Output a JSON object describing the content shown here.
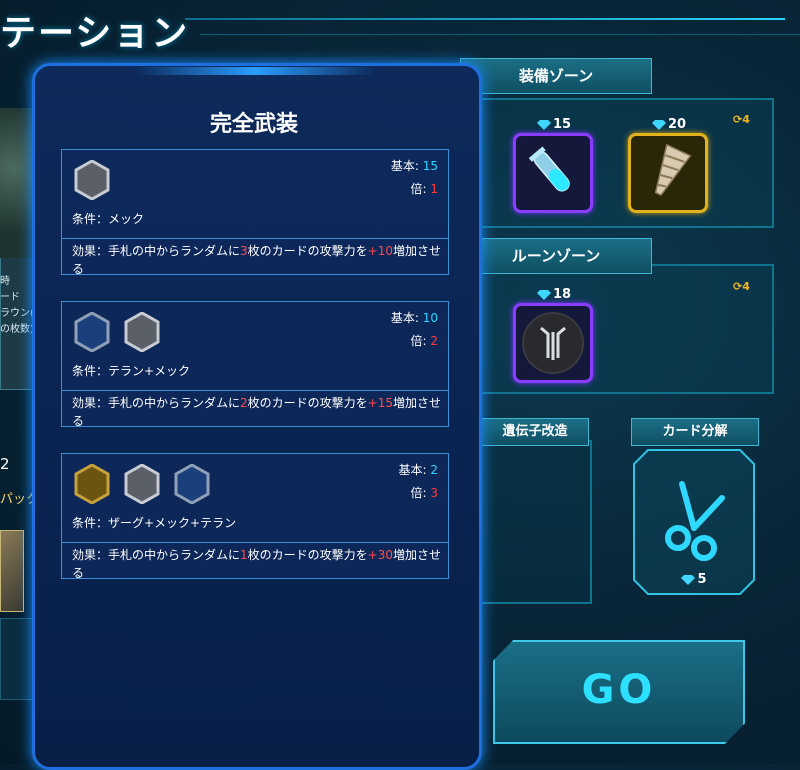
{
  "header": {
    "title": "テーション"
  },
  "left_fragments": {
    "lines": [
      "時",
      "ード",
      "ラウン(",
      "の枚数)"
    ],
    "count": "2",
    "pack_label": "パック"
  },
  "equip_zone": {
    "label": "装備ゾーン",
    "refresh_count": "4",
    "slots": [
      {
        "cost": "15",
        "icon": "test-tube-icon",
        "frame": "purple"
      },
      {
        "cost": "20",
        "icon": "drill-icon",
        "frame": "gold"
      }
    ]
  },
  "rune_zone": {
    "label": "ルーンゾーン",
    "refresh_count": "4",
    "slots": [
      {
        "cost": "18",
        "icon": "rune-emblem-icon",
        "frame": "purple"
      }
    ]
  },
  "gene_mod": {
    "label": "遺伝子改造"
  },
  "card_disassemble": {
    "label": "カード分解",
    "cost": "5"
  },
  "go_button": {
    "label": "GO"
  },
  "modal": {
    "title": "完全武装",
    "base_label": "基本:",
    "mult_label": "倍:",
    "cards": [
      {
        "base": "15",
        "mult": "1",
        "condition": "条件：メック",
        "effect_pre": "効果：手札の中からランダムに",
        "effect_num": "3",
        "effect_mid": "枚のカードの攻撃力を",
        "effect_bonus": "+10",
        "effect_post": "増加させる",
        "hexes": [
          "silver"
        ]
      },
      {
        "base": "10",
        "mult": "2",
        "condition": "条件：テラン+メック",
        "effect_pre": "効果：手札の中からランダムに",
        "effect_num": "2",
        "effect_mid": "枚のカードの攻撃力を",
        "effect_bonus": "+15",
        "effect_post": "増加させる",
        "hexes": [
          "blue",
          "silver"
        ]
      },
      {
        "base": "2",
        "mult": "3",
        "condition": "条件：ザーグ+メック+テラン",
        "effect_pre": "効果：手札の中からランダムに",
        "effect_num": "1",
        "effect_mid": "枚のカードの攻撃力を",
        "effect_bonus": "+30",
        "effect_post": "増加させる",
        "hexes": [
          "gold",
          "silver",
          "blue"
        ]
      }
    ]
  },
  "colors": {
    "accent": "#2ed8ff",
    "highlight": "#ff3a3a",
    "purple_frame": "#8b3dff",
    "gold_frame": "#e0b21e"
  }
}
